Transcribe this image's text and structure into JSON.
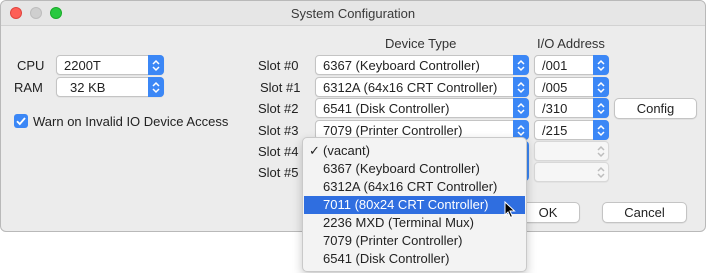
{
  "window": {
    "title": "System Configuration"
  },
  "left": {
    "cpu_label": "CPU",
    "cpu_value": "2200T",
    "ram_label": "RAM",
    "ram_value": "32 KB",
    "warn_label": "Warn on Invalid IO Device Access",
    "warn_checked": true
  },
  "headers": {
    "device_type": "Device Type",
    "io_address": "I/O Address"
  },
  "slots": [
    {
      "label": "Slot #0",
      "device": "6367 (Keyboard Controller)",
      "address": "/001"
    },
    {
      "label": "Slot #1",
      "device": "6312A (64x16 CRT Controller)",
      "address": "/005"
    },
    {
      "label": "Slot #2",
      "device": "6541 (Disk Controller)",
      "address": "/310"
    },
    {
      "label": "Slot #3",
      "device": "7079 (Printer Controller)",
      "address": "/215"
    },
    {
      "label": "Slot #4",
      "device": "",
      "address": ""
    },
    {
      "label": "Slot #5",
      "device": "",
      "address": ""
    }
  ],
  "buttons": {
    "config": "Config",
    "ok": "OK",
    "cancel": "Cancel"
  },
  "menu": {
    "checked_item": "(vacant)",
    "selected_item": "7011 (80x24 CRT Controller)",
    "items": [
      "(vacant)",
      "6367 (Keyboard Controller)",
      "6312A (64x16 CRT Controller)",
      "7011 (80x24 CRT Controller)",
      "2236 MXD (Terminal Mux)",
      "7079 (Printer Controller)",
      "6541 (Disk Controller)"
    ]
  },
  "colors": {
    "accent": "#3b87f6",
    "selection": "#2f6ee0",
    "window_bg": "#ececec"
  }
}
